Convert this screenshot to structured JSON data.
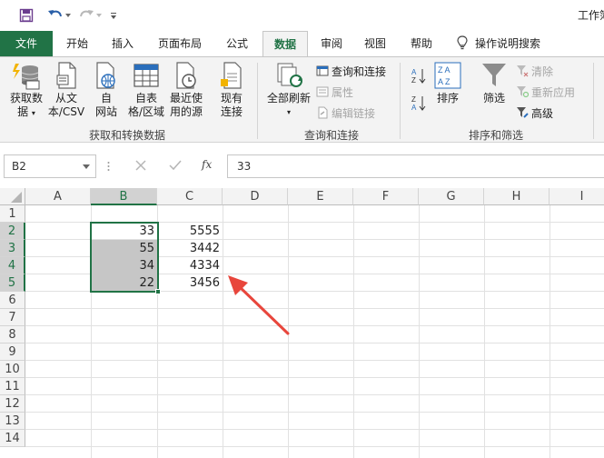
{
  "qat": {
    "save_icon": "save-icon",
    "undo_icon": "undo-icon",
    "redo_icon": "redo-icon",
    "customize_icon": "customize-qat-icon",
    "window_title": "工作簿"
  },
  "tabs": [
    "文件",
    "开始",
    "插入",
    "页面布局",
    "公式",
    "数据",
    "审阅",
    "视图",
    "帮助"
  ],
  "active_tab": "数据",
  "tell_me": "操作说明搜索",
  "ribbon": {
    "get_transform": {
      "label": "获取和转换数据",
      "buttons": [
        {
          "line1": "获取数",
          "line2": "据"
        },
        {
          "line1": "从文",
          "line2": "本/CSV"
        },
        {
          "line1": "自",
          "line2": "网站"
        },
        {
          "line1": "自表",
          "line2": "格/区域"
        },
        {
          "line1": "最近使",
          "line2": "用的源"
        },
        {
          "line1": "现有",
          "line2": "连接"
        }
      ]
    },
    "queries": {
      "label": "查询和连接",
      "refresh_line1": "全部刷新",
      "queries_connections": "查询和连接",
      "properties": "属性",
      "edit_links": "编辑链接"
    },
    "sort_filter": {
      "label": "排序和筛选",
      "sort": "排序",
      "filter": "筛选",
      "clear": "清除",
      "reapply": "重新应用",
      "advanced": "高级"
    }
  },
  "formula_bar": {
    "name_box": "B2",
    "fx_label": "fx",
    "value": "33"
  },
  "grid": {
    "columns": [
      "A",
      "B",
      "C",
      "D",
      "E",
      "F",
      "G",
      "H",
      "I"
    ],
    "rows": [
      "1",
      "2",
      "3",
      "4",
      "5",
      "6",
      "7",
      "8",
      "9",
      "10",
      "11",
      "12",
      "13",
      "14"
    ],
    "b_values": [
      "33",
      "55",
      "34",
      "22"
    ],
    "c_values": [
      "5555",
      "3442",
      "4334",
      "3456"
    ]
  },
  "colors": {
    "excel_green": "#217346",
    "arrow_red": "#e8463c",
    "selection_fill": "#c6c6c6"
  }
}
